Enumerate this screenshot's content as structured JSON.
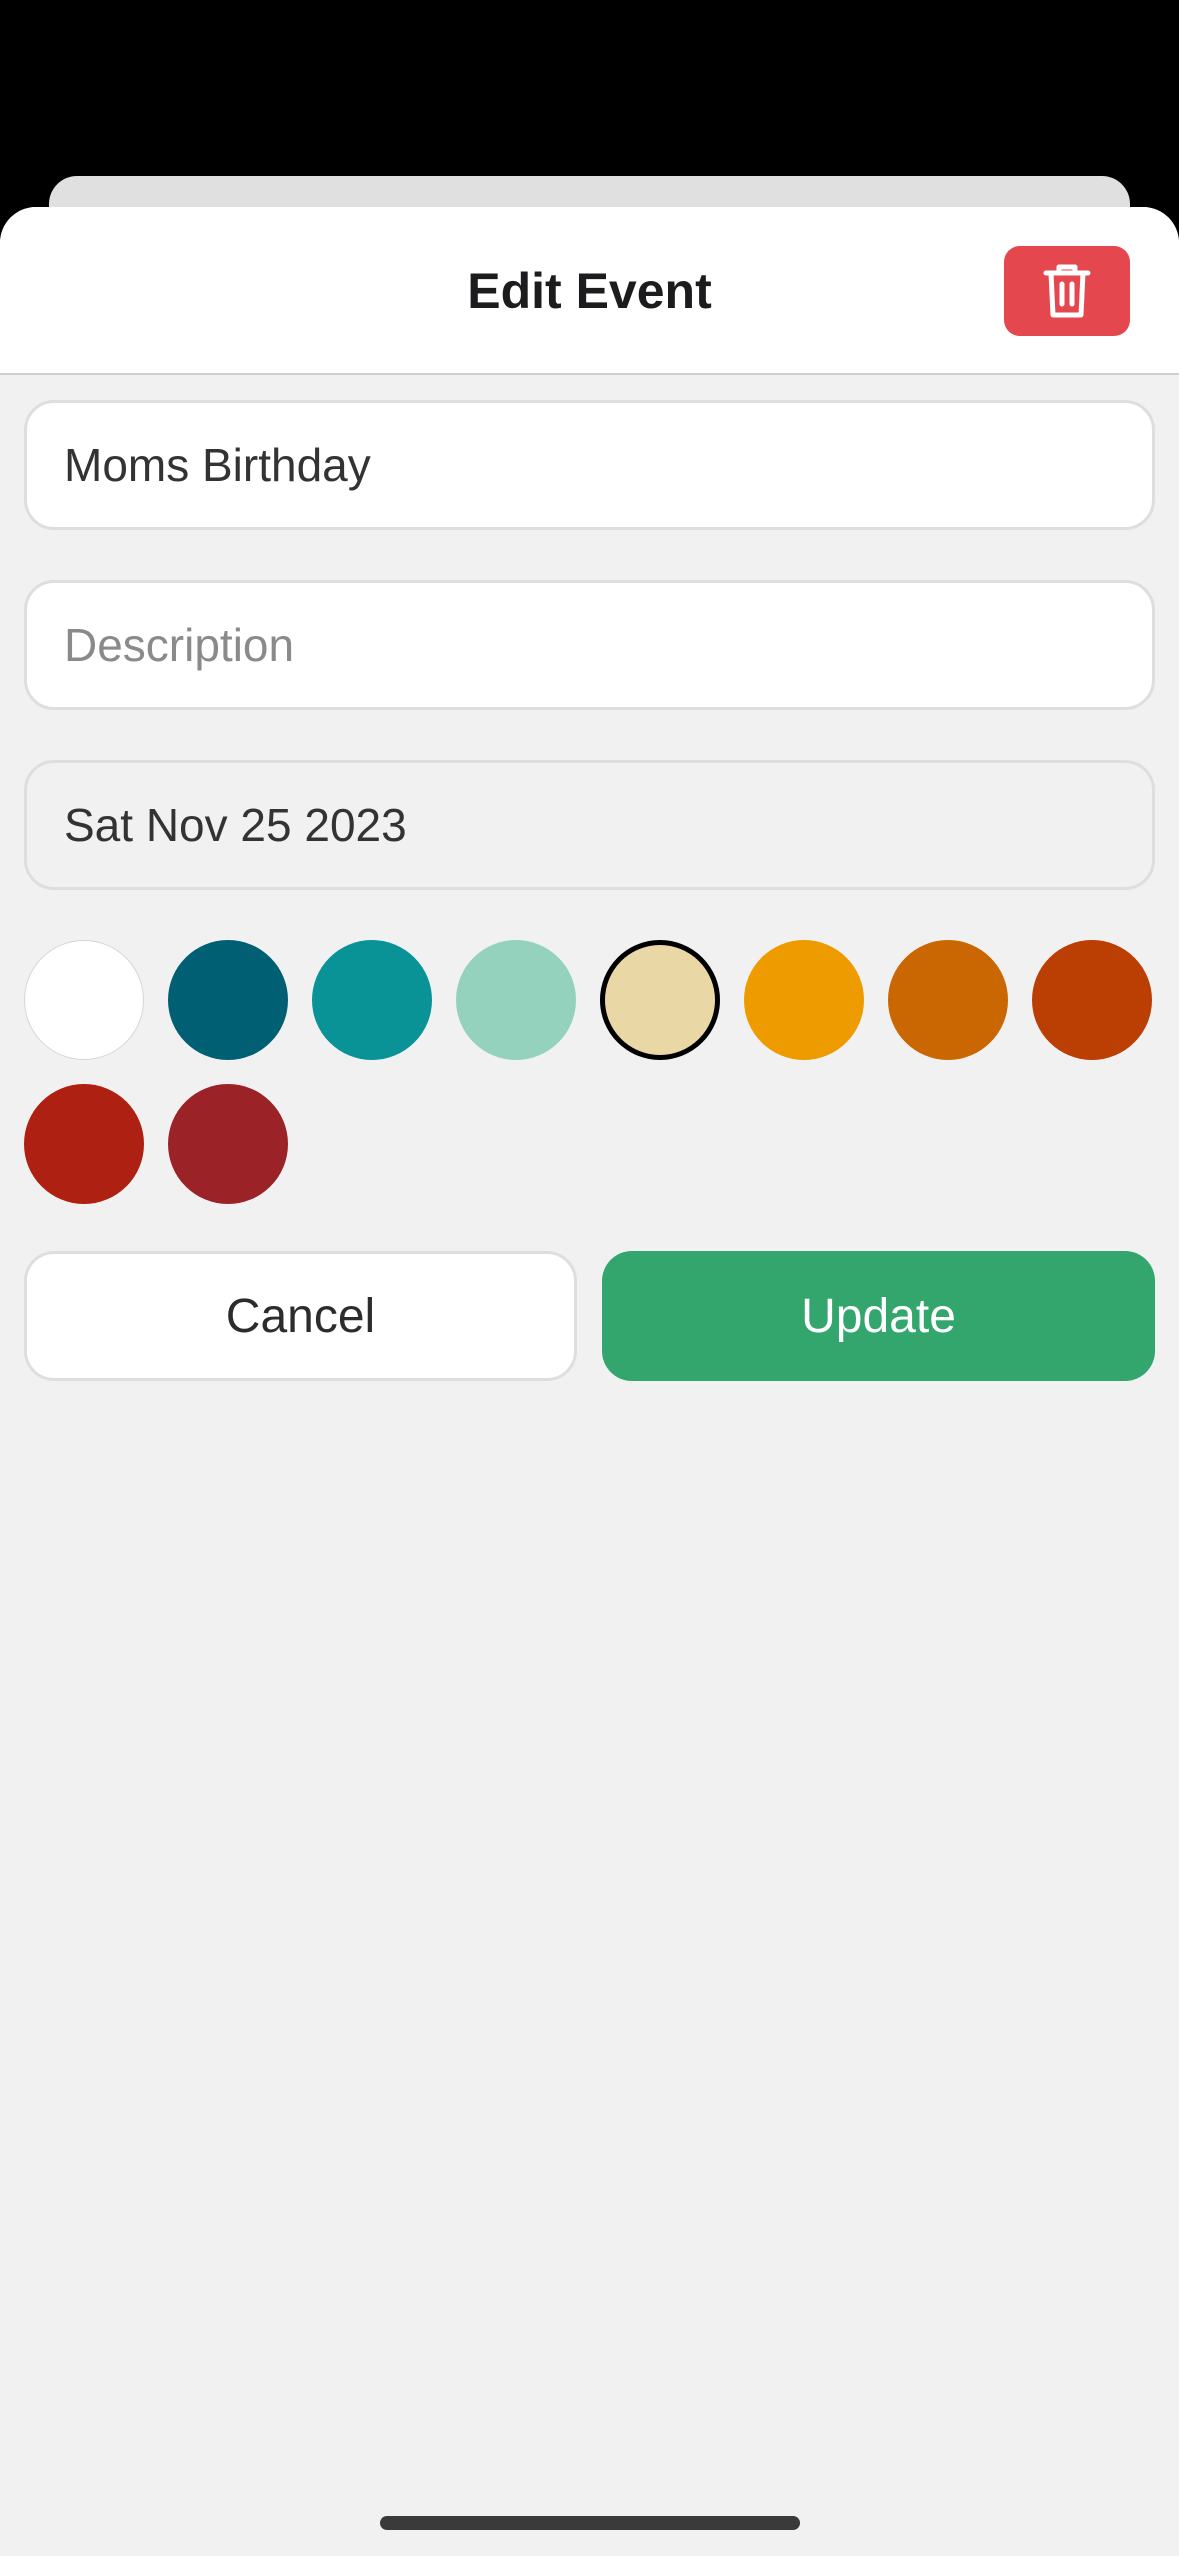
{
  "header": {
    "title": "Edit Event"
  },
  "form": {
    "title_value": "Moms Birthday",
    "description_placeholder": "Description",
    "description_value": "",
    "date_value": "Sat Nov 25 2023"
  },
  "color_picker": {
    "options": [
      "#ffffff",
      "#005f73",
      "#0a9396",
      "#94d2bd",
      "#e9d8a6",
      "#ee9b00",
      "#ca6702",
      "#bb3e03",
      "#ae2012",
      "#9b2226"
    ],
    "selected": "#e9d8a6"
  },
  "actions": {
    "cancel_label": "Cancel",
    "update_label": "Update"
  },
  "colors": {
    "delete": "#e5474f",
    "update": "#33a66d"
  }
}
